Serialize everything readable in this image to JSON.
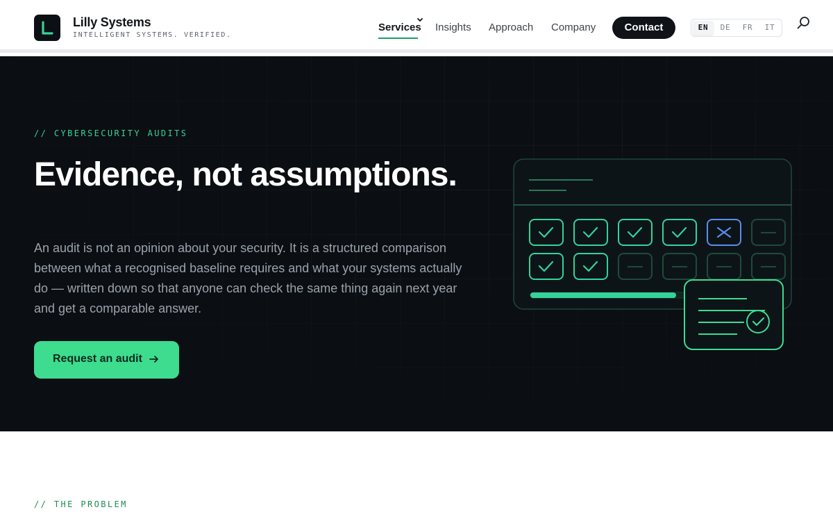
{
  "brand": {
    "name": "Lilly Systems",
    "tagline": "INTELLIGENT SYSTEMS. VERIFIED.",
    "logo_icon": "L-logo-icon",
    "accent_color": "#34d399"
  },
  "nav": {
    "items": [
      {
        "label": "Services",
        "active": true,
        "has_dropdown": true
      },
      {
        "label": "Insights"
      },
      {
        "label": "Approach"
      },
      {
        "label": "Company"
      }
    ],
    "contact_label": "Contact",
    "languages": [
      "EN",
      "DE",
      "FR",
      "IT"
    ],
    "active_language": "EN",
    "search_icon": "search-icon"
  },
  "hero": {
    "eyebrow": "// CYBERSECURITY AUDITS",
    "title": "Evidence, not assumptions.",
    "body": "An audit is not an opinion about your security. It is a structured comparison between what a recognised baseline requires and what your systems actually do — written down so that anyone can check the same thing again next year and get a comparable answer.",
    "cta_label": "Request an audit",
    "cta_icon": "arrow-right-icon",
    "background_color": "#0b0e12"
  },
  "problem": {
    "eyebrow": "// THE PROBLEM"
  }
}
